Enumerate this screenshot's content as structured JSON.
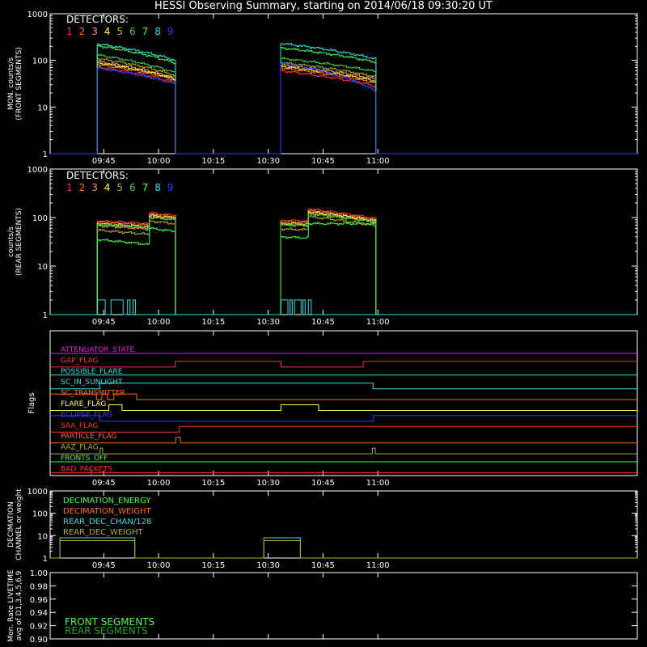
{
  "title": "HESSI Observing Summary, starting on 2014/06/18 09:30:20 UT",
  "chart_data": [
    {
      "type": "line",
      "ylabel": [
        "MON. counts/s",
        "(FRONT SEGMENTS)"
      ],
      "ylog": true,
      "ylim": [
        1,
        1000
      ],
      "yticks": [
        "1",
        "10",
        "100",
        "1000"
      ],
      "xlim": [
        570.33,
        731
      ],
      "xticks": [
        {
          "v": 585,
          "label": "09:45"
        },
        {
          "v": 600,
          "label": "10:00"
        },
        {
          "v": 615,
          "label": "10:15"
        },
        {
          "v": 630,
          "label": "10:30"
        },
        {
          "v": 645,
          "label": "10:45"
        },
        {
          "v": 660,
          "label": "11:00"
        }
      ],
      "legend_title": "DETECTORS:",
      "series": [
        {
          "name": "1",
          "color": "#ff3030",
          "v1": [
            72,
            33
          ],
          "v2": [
            60,
            28
          ]
        },
        {
          "name": "2",
          "color": "#ff6a1a",
          "v1": [
            82,
            38
          ],
          "v2": [
            68,
            33
          ]
        },
        {
          "name": "3",
          "color": "#ff9060",
          "v1": [
            95,
            42
          ],
          "v2": [
            80,
            40
          ]
        },
        {
          "name": "4",
          "color": "#ffff40",
          "v1": [
            88,
            40
          ],
          "v2": [
            74,
            36
          ]
        },
        {
          "name": "5",
          "color": "#b0b030",
          "v1": [
            110,
            48
          ],
          "v2": [
            90,
            45
          ]
        },
        {
          "name": "6",
          "color": "#40d040",
          "v1": [
            130,
            55
          ],
          "v2": [
            110,
            58
          ]
        },
        {
          "name": "7",
          "color": "#40ff40",
          "v1": [
            205,
            88
          ],
          "v2": [
            185,
            92
          ]
        },
        {
          "name": "8",
          "color": "#30e0e0",
          "v1": [
            225,
            102
          ],
          "v2": [
            230,
            108
          ]
        },
        {
          "name": "9",
          "color": "#3040ff",
          "v1": [
            68,
            32
          ],
          "v2": [
            88,
            22
          ]
        }
      ]
    },
    {
      "type": "line",
      "ylabel": [
        "counts/s",
        "(REAR SEGMENTS)"
      ],
      "ylog": true,
      "ylim": [
        1,
        1000
      ],
      "yticks": [
        "1",
        "10",
        "100",
        "1000"
      ],
      "legend_title": "DETECTORS:",
      "series": [
        {
          "name": "1",
          "color": "#ff3030",
          "a": [
            85,
            75
          ],
          "b": [
            125,
            110
          ],
          "c": [
            88,
            85
          ],
          "d": [
            150,
            95
          ]
        },
        {
          "name": "2",
          "color": "#ff6a1a",
          "a": [
            80,
            70
          ],
          "b": [
            118,
            105
          ],
          "c": [
            82,
            80
          ],
          "d": [
            140,
            90
          ]
        },
        {
          "name": "3",
          "color": "#ff9060",
          "a": [
            68,
            58
          ],
          "b": [
            105,
            92
          ],
          "c": [
            70,
            68
          ],
          "d": [
            125,
            82
          ]
        },
        {
          "name": "4",
          "color": "#ffff40",
          "a": [
            75,
            64
          ],
          "b": [
            110,
            98
          ],
          "c": [
            76,
            74
          ],
          "d": [
            132,
            86
          ]
        },
        {
          "name": "5",
          "color": "#b0b030",
          "a": [
            55,
            45
          ],
          "b": [
            85,
            75
          ],
          "c": [
            58,
            56
          ],
          "d": [
            105,
            68
          ]
        },
        {
          "name": "6",
          "color": "#40d040",
          "a": [
            72,
            62
          ],
          "b": [
            100,
            90
          ],
          "c": [
            74,
            72
          ],
          "d": [
            118,
            80
          ]
        },
        {
          "name": "7",
          "color": "#40ff40",
          "a": [
            35,
            28
          ],
          "b": [
            60,
            52
          ],
          "c": [
            40,
            38
          ],
          "d": [
            75,
            75
          ]
        },
        {
          "name": "8",
          "color": "#30e0e0"
        },
        {
          "name": "9",
          "color": "#3040ff"
        }
      ]
    },
    {
      "type": "flags",
      "ylabel": "Flags",
      "flags": [
        {
          "name": "ATTENUATOR_STATE",
          "color": "#e020e0",
          "steps": []
        },
        {
          "name": "GAP_FLAG",
          "color": "#ff3030",
          "steps": [
            [
              570.33,
              0
            ],
            [
              604.5,
              1
            ],
            [
              633.5,
              0
            ],
            [
              656.0,
              1
            ]
          ]
        },
        {
          "name": "POSSIBLE_FLARE",
          "color": "#30e0e0",
          "steps": []
        },
        {
          "name": "SC_IN_SUNLIGHT",
          "color": "#30e0e0",
          "steps": [
            [
              570.33,
              0
            ],
            [
              583.9,
              1
            ],
            [
              658.7,
              0
            ]
          ]
        },
        {
          "name": "SC_TRANSMITTER",
          "color": "#ff6a1a",
          "steps": [
            [
              570.33,
              1
            ],
            [
              583.0,
              0
            ],
            [
              584.5,
              1
            ],
            [
              586.0,
              0
            ],
            [
              587.8,
              1
            ],
            [
              594.0,
              0
            ]
          ]
        },
        {
          "name": "FLARE_FLAG",
          "color": "#ffff40",
          "steps": [
            [
              570.33,
              0
            ],
            [
              586.4,
              1
            ],
            [
              590.0,
              0
            ],
            [
              633.5,
              1
            ],
            [
              643.8,
              0
            ]
          ]
        },
        {
          "name": "ECLIPSE_FLAG",
          "color": "#3040ff",
          "steps": [
            [
              570.33,
              1
            ],
            [
              583.9,
              0
            ],
            [
              658.7,
              1
            ]
          ]
        },
        {
          "name": "SAA_FLAG",
          "color": "#ff3030",
          "steps": [
            [
              570.33,
              0
            ],
            [
              605.7,
              1
            ]
          ]
        },
        {
          "name": "PARTICLE_FLAG",
          "color": "#ff6a1a",
          "steps": [
            [
              570.33,
              0
            ],
            [
              604.7,
              1
            ],
            [
              606.0,
              0
            ]
          ]
        },
        {
          "name": "AAZ_FLAG",
          "color": "#b0b030",
          "steps": [
            [
              570.33,
              0
            ],
            [
              584.0,
              1
            ],
            [
              584.7,
              0
            ],
            [
              658.5,
              1
            ],
            [
              659.3,
              0
            ]
          ]
        },
        {
          "name": "FRONTS_OFF",
          "color": "#40ff40",
          "steps": []
        },
        {
          "name": "BAD_PACKETS",
          "color": "#ff3030",
          "steps": [],
          "spike": 581.6
        }
      ]
    },
    {
      "type": "line",
      "ylabel": [
        "DECIMATION",
        "CHANNEL or weight"
      ],
      "ylog": true,
      "ylim": [
        1,
        1000
      ],
      "yticks": [
        "1",
        "10",
        "100",
        "1000"
      ],
      "series": [
        {
          "name": "DECIMATION_ENERGY",
          "color": "#40ff40"
        },
        {
          "name": "DECIMATION_WEIGHT",
          "color": "#ff6a1a"
        },
        {
          "name": "REAR_DEC_CHAN/128",
          "color": "#30e0e0",
          "steps": [
            [
              570.33,
              1
            ],
            [
              573.0,
              8
            ],
            [
              593.5,
              1
            ],
            [
              628.8,
              8
            ],
            [
              638.8,
              1
            ]
          ]
        },
        {
          "name": "REAR_DEC_WEIGHT",
          "color": "#b0b030",
          "steps": [
            [
              570.33,
              1
            ],
            [
              573.0,
              6
            ],
            [
              593.5,
              1
            ],
            [
              628.8,
              6
            ],
            [
              638.8,
              1
            ]
          ]
        }
      ]
    },
    {
      "type": "line",
      "ylabel": [
        "Mon. Rate LIVETIME",
        "avg of D1,3,4,5,6,9"
      ],
      "ylim": [
        0.9,
        1.0
      ],
      "yticks": [
        "0.90",
        "0.92",
        "0.94",
        "0.96",
        "0.98",
        "1.00"
      ],
      "series": [
        {
          "name": "FRONT SEGMENTS",
          "color": "#40ff40"
        },
        {
          "name": "REAR SEGMENTS",
          "color": "#20a020"
        }
      ]
    }
  ]
}
